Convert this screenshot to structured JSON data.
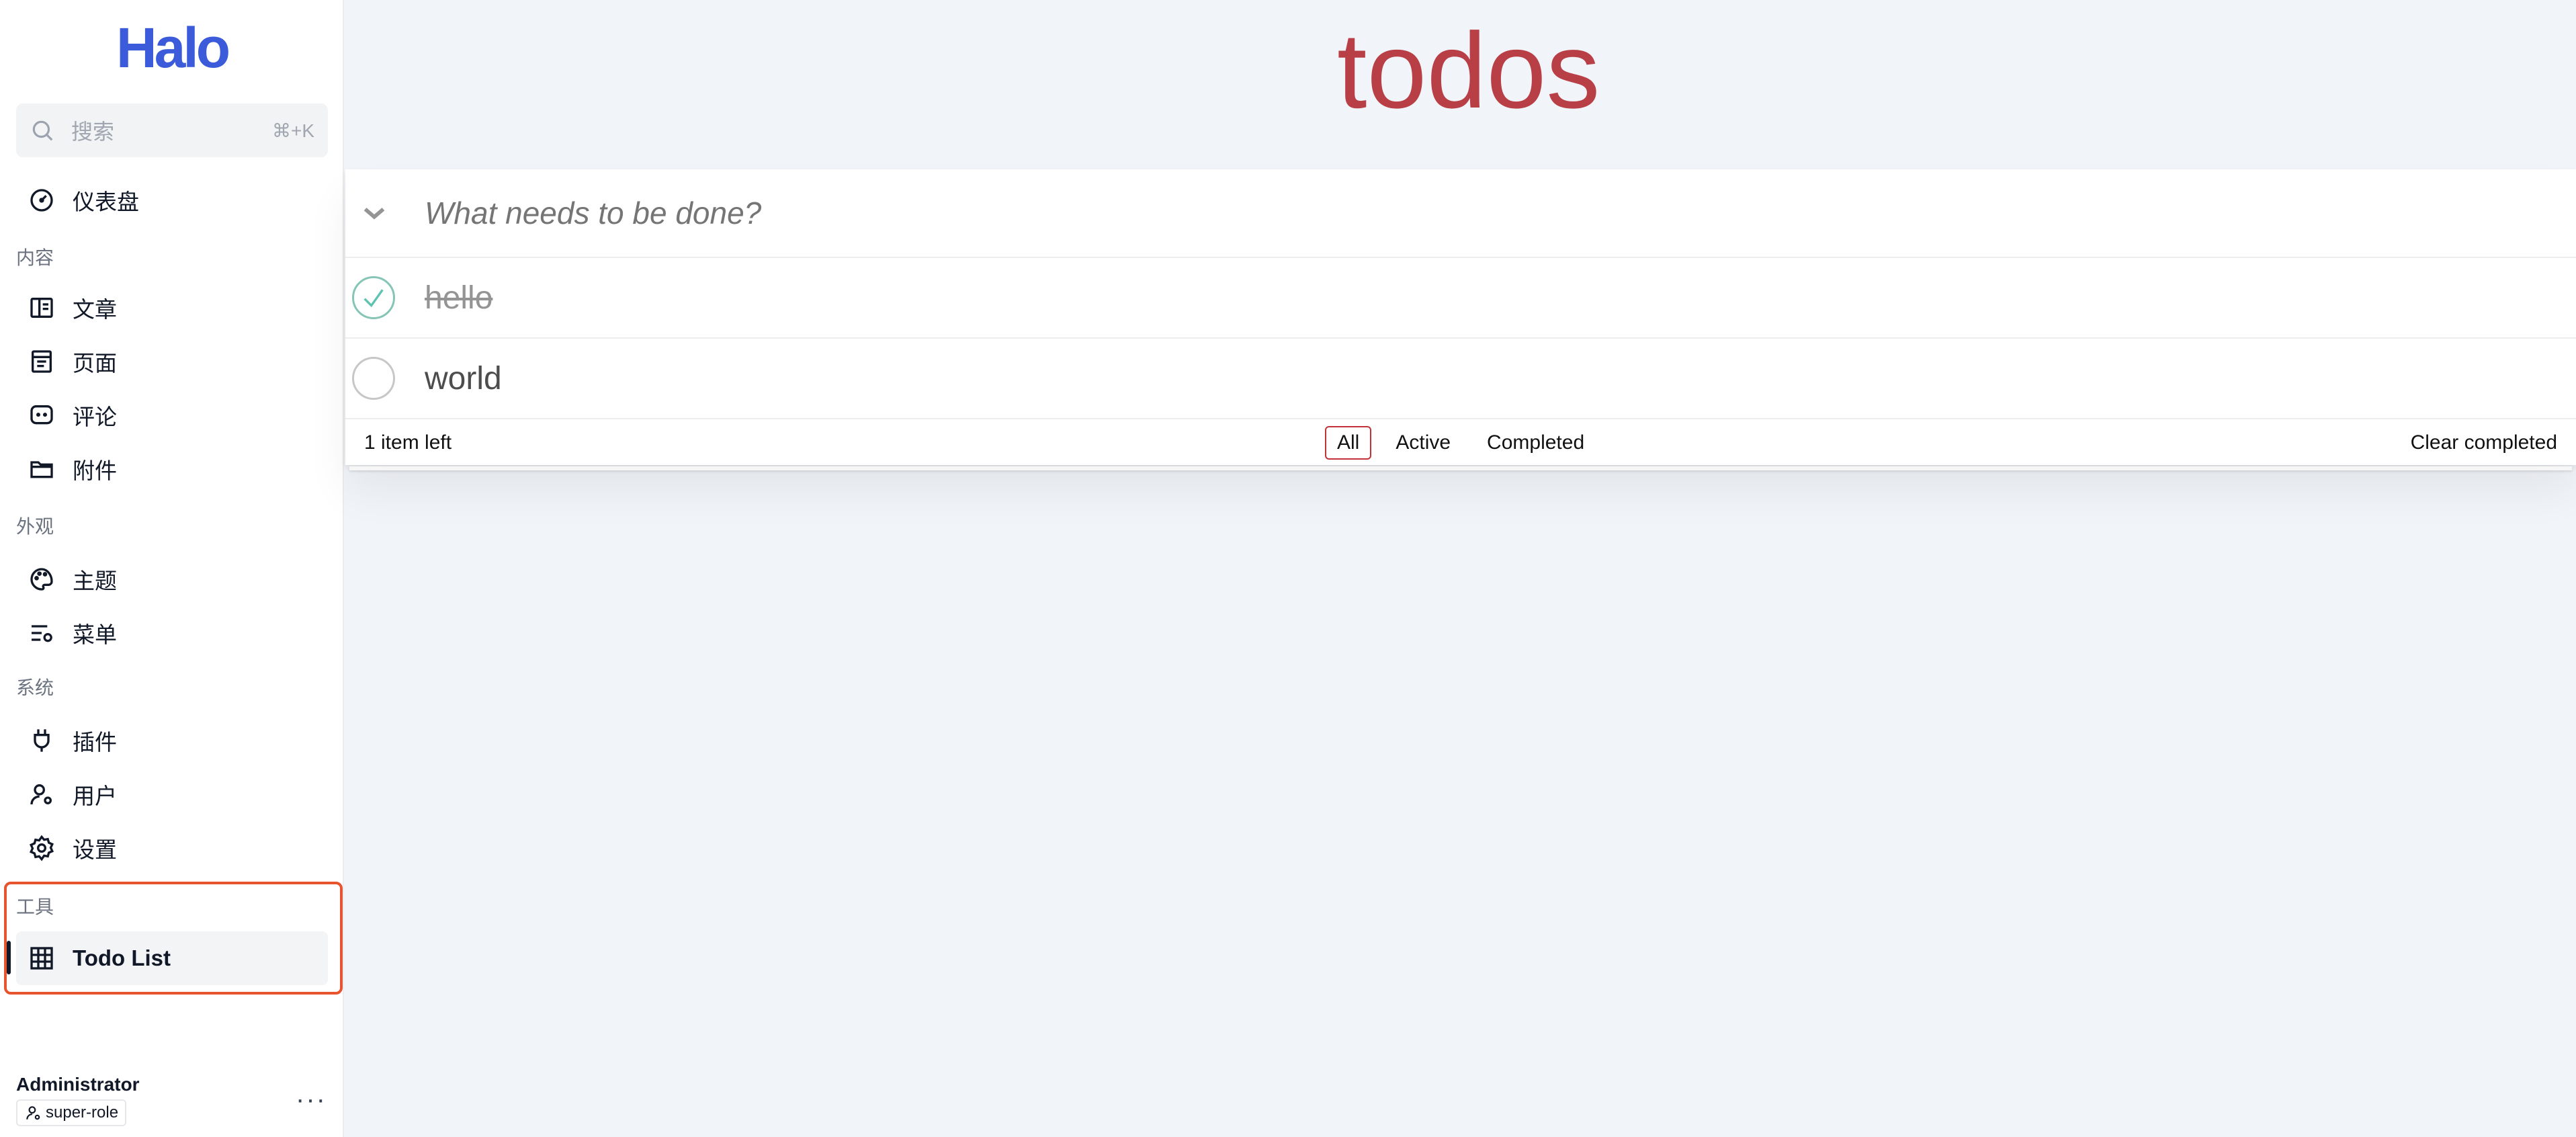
{
  "sidebar": {
    "logo": "Halo",
    "search": {
      "placeholder": "搜索",
      "shortcut": "⌘+K"
    },
    "dashboard": {
      "label": "仪表盘",
      "icon": "dashboard-gauge-icon"
    },
    "groups": [
      {
        "title": "内容",
        "items": [
          {
            "label": "文章",
            "icon": "book-open-icon"
          },
          {
            "label": "页面",
            "icon": "page-layout-icon"
          },
          {
            "label": "评论",
            "icon": "comment-icon"
          },
          {
            "label": "附件",
            "icon": "folder-icon"
          }
        ]
      },
      {
        "title": "外观",
        "items": [
          {
            "label": "主题",
            "icon": "palette-icon"
          },
          {
            "label": "菜单",
            "icon": "menu-settings-icon"
          }
        ]
      },
      {
        "title": "系统",
        "items": [
          {
            "label": "插件",
            "icon": "plug-icon"
          },
          {
            "label": "用户",
            "icon": "user-gear-icon"
          },
          {
            "label": "设置",
            "icon": "gear-icon"
          }
        ]
      },
      {
        "title": "工具",
        "items": [
          {
            "label": "Todo List",
            "icon": "grid-table-icon",
            "active": true
          }
        ]
      }
    ],
    "user": {
      "name": "Administrator",
      "role": "super-role",
      "more": "···"
    }
  },
  "main": {
    "title": "todos",
    "new_todo_placeholder": "What needs to be done?",
    "todos": [
      {
        "text": "hello",
        "completed": true
      },
      {
        "text": "world",
        "completed": false
      }
    ],
    "footer": {
      "count": "1 item left",
      "filters": [
        "All",
        "Active",
        "Completed"
      ],
      "selected_filter": "All",
      "clear": "Clear completed"
    }
  },
  "colors": {
    "brand": "#3b5bdb",
    "title": "#b83f45",
    "highlight_box": "#e8542e",
    "check_done": "#5dc2af"
  }
}
